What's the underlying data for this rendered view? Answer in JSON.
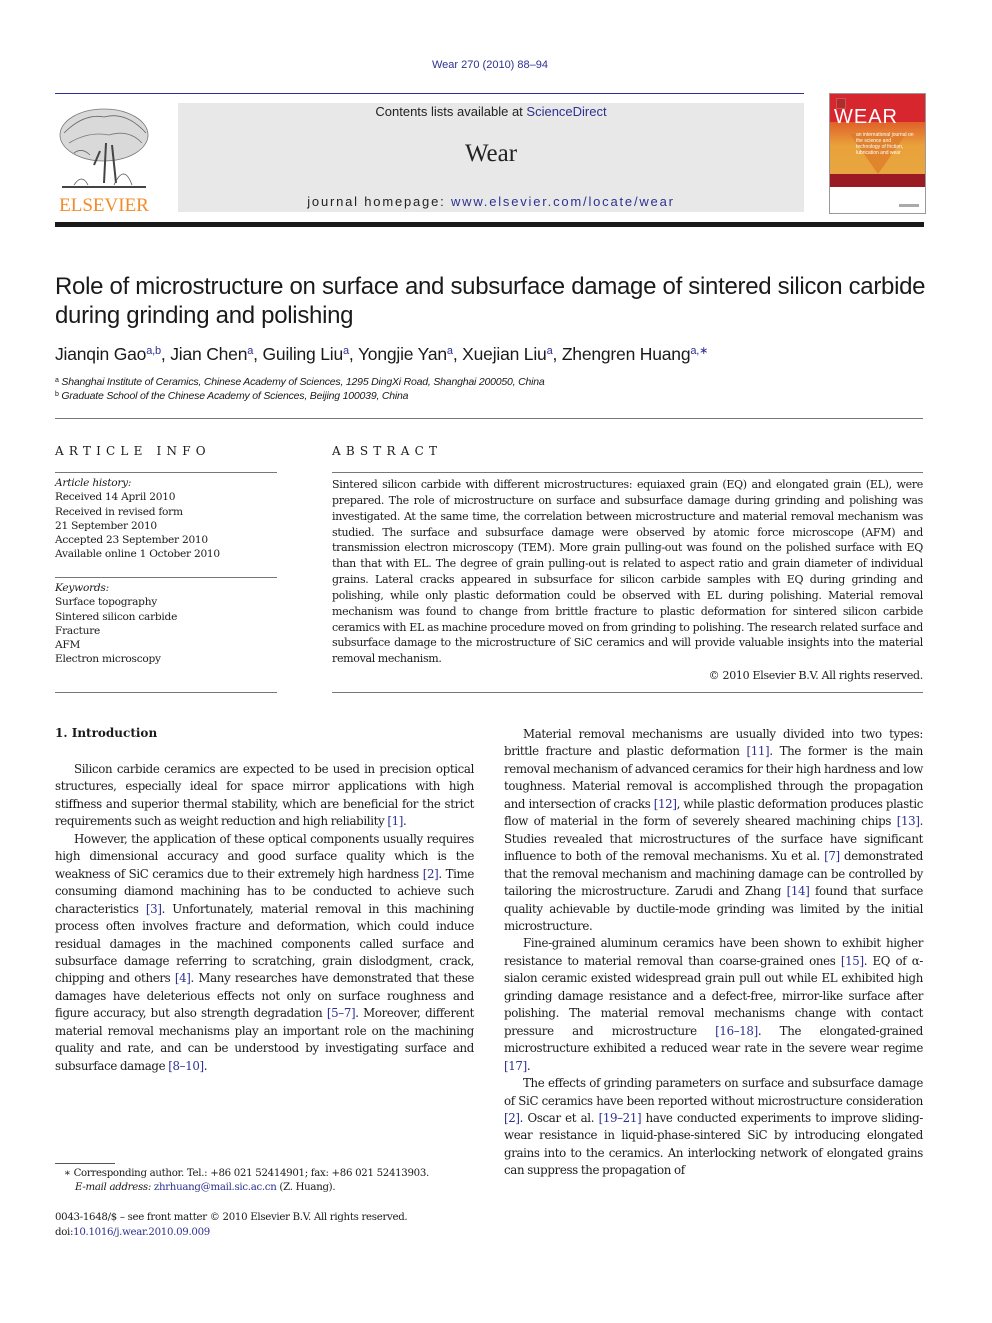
{
  "running_head": "Wear 270 (2010) 88–94",
  "masthead": {
    "publisher_logo_text": "ELSEVIER",
    "contents_prefix": "Contents lists available at ",
    "contents_link": "ScienceDirect",
    "journal_name": "Wear",
    "homepage_prefix": "journal homepage: ",
    "homepage_link": "www.elsevier.com/locate/wear",
    "cover_title": "WEAR",
    "cover_subtitle": "an international journal on the science and technology of friction, lubrication and wear",
    "colors": {
      "link": "#2e3192",
      "elsevier_orange": "#f28c28",
      "cover_red": "#d7262e",
      "header_box": "#e8e8e8"
    }
  },
  "article": {
    "title": "Role of microstructure on surface and subsurface damage of sintered silicon carbide during grinding and polishing",
    "authors": [
      {
        "name": "Jianqin Gao",
        "affil": "a,b"
      },
      {
        "name": "Jian Chen",
        "affil": "a"
      },
      {
        "name": "Guiling Liu",
        "affil": "a"
      },
      {
        "name": "Yongjie Yan",
        "affil": "a"
      },
      {
        "name": "Xuejian Liu",
        "affil": "a"
      },
      {
        "name": "Zhengren Huang",
        "affil": "a,∗"
      }
    ],
    "affiliations": [
      {
        "mark": "a",
        "text": "Shanghai Institute of Ceramics, Chinese Academy of Sciences, 1295 DingXi Road, Shanghai 200050, China"
      },
      {
        "mark": "b",
        "text": "Graduate School of the Chinese Academy of Sciences, Beijing 100039, China"
      }
    ]
  },
  "article_info": {
    "label": "ARTICLE INFO",
    "history_label": "Article history:",
    "history": [
      "Received 14 April 2010",
      "Received in revised form",
      "21 September 2010",
      "Accepted 23 September 2010",
      "Available online 1 October 2010"
    ],
    "keywords_label": "Keywords:",
    "keywords": [
      "Surface topography",
      "Sintered silicon carbide",
      "Fracture",
      "AFM",
      "Electron microscopy"
    ]
  },
  "abstract": {
    "label": "ABSTRACT",
    "text": "Sintered silicon carbide with different microstructures: equiaxed grain (EQ) and elongated grain (EL), were prepared. The role of microstructure on surface and subsurface damage during grinding and pol­ishing was investigated. At the same time, the correlation between microstructure and material removal mechanism was studied. The surface and subsurface damage were observed by atomic force microscope (AFM) and transmission electron microscopy (TEM). More grain pulling-out was found on the polished surface with EQ than that with EL. The degree of grain pulling-out is related to aspect ratio and grain diameter of individual grains. Lateral cracks appeared in subsurface for silicon carbide samples with EQ during grinding and polishing, while only plastic deformation could be observed with EL during polish­ing. Material removal mechanism was found to change from brittle fracture to plastic deformation for sintered silicon carbide ceramics with EL as machine procedure moved on from grinding to polishing. The research related surface and subsurface damage to the microstructure of SiC ceramics and will provide valuable insights into the material removal mechanism.",
    "copyright": "© 2010 Elsevier B.V. All rights reserved."
  },
  "body": {
    "section_heading": "1.  Introduction",
    "left_paragraphs": [
      [
        {
          "t": "Silicon carbide ceramics are expected to be used in precision optical structures, especially ideal for space mirror applications with high stiffness and superior thermal stability, which are bene­ficial for the strict requirements such as weight reduction and high reliability "
        },
        {
          "c": "[1]"
        },
        {
          "t": "."
        }
      ],
      [
        {
          "t": "However, the application of these optical components usually requires high dimensional accuracy and good surface quality which is the weakness of SiC ceramics due to their extremely high hard­ness "
        },
        {
          "c": "[2]"
        },
        {
          "t": ". Time consuming diamond machining has to be conducted to achieve such characteristics "
        },
        {
          "c": "[3]"
        },
        {
          "t": ". Unfortunately, material removal in this machining process often involves fracture and deformation, which could induce residual damages in the machined components called surface and subsurface damage referring to scratching, grain dislodgment, crack, chipping and others "
        },
        {
          "c": "[4]"
        },
        {
          "t": ". Many researches have demonstrated that these damages have deleterious effects not only on surface roughness and figure accuracy, but also strength degra­dation "
        },
        {
          "c": "[5–7]"
        },
        {
          "t": ". Moreover, different material removal mechanisms play an important role on the machining quality and rate, and can be understood by investigating surface and subsurface damage "
        },
        {
          "c": "[8–10]"
        },
        {
          "t": "."
        }
      ]
    ],
    "right_paragraphs": [
      [
        {
          "t": "Material removal mechanisms are usually divided into two types: brittle fracture and plastic deformation "
        },
        {
          "c": "[11]"
        },
        {
          "t": ". The former is the main removal mechanism of advanced ceramics for their high hardness and low toughness. Material removal is accomplished through the propagation and intersection of cracks "
        },
        {
          "c": "[12]"
        },
        {
          "t": ", while plastic deformation produces plastic flow of material in the form of severely sheared machining chips "
        },
        {
          "c": "[13]"
        },
        {
          "t": ". Studies revealed that microstructures of the surface have significant influence to both of the removal mechanisms. Xu et al. "
        },
        {
          "c": "[7]"
        },
        {
          "t": " demonstrated that the removal mechanism and machining damage can be controlled by tailoring the microstructure. Zarudi and Zhang "
        },
        {
          "c": "[14]"
        },
        {
          "t": " found that sur­face quality achievable by ductile-mode grinding was limited by the initial microstructure."
        }
      ],
      [
        {
          "t": "Fine-grained aluminum ceramics have been shown to exhibit higher resistance to material removal than coarse-grained ones "
        },
        {
          "c": "[15]"
        },
        {
          "t": ". EQ of α-sialon ceramic existed widespread grain pull out while EL exhibited high grinding damage resistance and a defect-free, mirror-like surface after polishing. The material removal mecha­nisms change with contact pressure and microstructure "
        },
        {
          "c": "[16–18]"
        },
        {
          "t": ". The elongated-grained microstructure exhibited a reduced wear rate in the severe wear regime "
        },
        {
          "c": "[17]"
        },
        {
          "t": "."
        }
      ],
      [
        {
          "t": "The effects of grinding parameters on surface and subsurface damage of SiC ceramics have been reported without microstructure consideration "
        },
        {
          "c": "[2]"
        },
        {
          "t": ". Oscar et al. "
        },
        {
          "c": "[19–21]"
        },
        {
          "t": " have conducted experiments to improve sliding-wear resistance in liquid-phase-sintered SiC by introducing elongated grains into to the ceramics. An interlock­ing network of elongated grains can suppress the propagation of"
        }
      ]
    ]
  },
  "footnotes": {
    "corresponding": "∗  Corresponding author. Tel.: +86 021 52414901; fax: +86 021 52413903.",
    "email_label": "E-mail address: ",
    "email": "zhrhuang@mail.sic.ac.cn",
    "email_suffix": " (Z. Huang).",
    "front_matter": "0043-1648/$ – see front matter © 2010 Elsevier B.V. All rights reserved.",
    "doi_label": "doi:",
    "doi": "10.1016/j.wear.2010.09.009"
  }
}
